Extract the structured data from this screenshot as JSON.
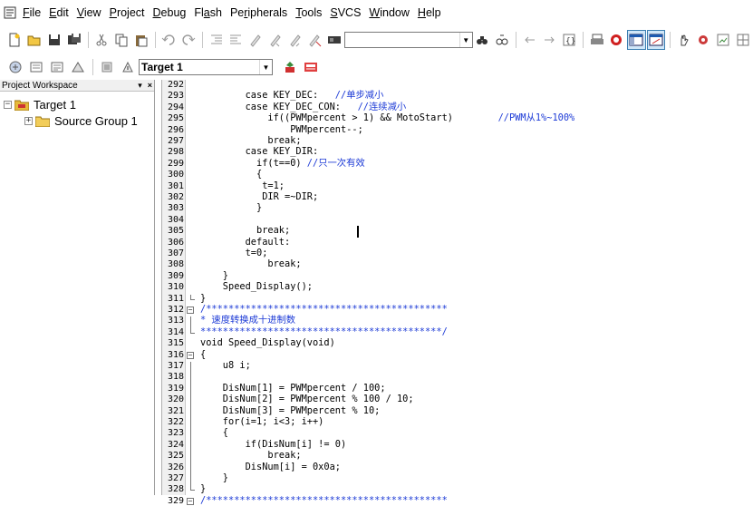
{
  "menu": {
    "items": [
      {
        "mnemonic": "F",
        "rest": "ile"
      },
      {
        "mnemonic": "E",
        "rest": "dit"
      },
      {
        "mnemonic": "V",
        "rest": "iew"
      },
      {
        "mnemonic": "P",
        "rest": "roject"
      },
      {
        "mnemonic": "D",
        "rest": "ebug"
      },
      {
        "pre": "Fl",
        "mnemonic": "a",
        "rest": "sh"
      },
      {
        "pre": "Pe",
        "mnemonic": "r",
        "rest": "ipherals"
      },
      {
        "mnemonic": "T",
        "rest": "ools"
      },
      {
        "mnemonic": "S",
        "rest": "VCS"
      },
      {
        "mnemonic": "W",
        "rest": "indow"
      },
      {
        "mnemonic": "H",
        "rest": "elp"
      }
    ]
  },
  "toolbar": {
    "find_combo_value": "",
    "target_combo_value": "Target 1"
  },
  "workspace": {
    "title": "Project Workspace",
    "pin_glyph": "▾",
    "close_glyph": "×",
    "tree": [
      {
        "label": "Target 1",
        "toggle": "−",
        "level": 0
      },
      {
        "label": "Source Group 1",
        "toggle": "+",
        "level": 1
      }
    ]
  },
  "editor": {
    "lines": [
      {
        "n": "292",
        "code": "",
        "comment": ""
      },
      {
        "n": "293",
        "code": "        case KEY_DEC:   ",
        "comment": "//单步减小"
      },
      {
        "n": "294",
        "code": "        case KEY_DEC_CON:   ",
        "comment": "//连续减小"
      },
      {
        "n": "295",
        "code": "            if((PWMpercent > 1) && MotoStart)        ",
        "comment": "//PWM从1%~100%"
      },
      {
        "n": "296",
        "code": "                PWMpercent--;",
        "comment": ""
      },
      {
        "n": "297",
        "code": "            break;",
        "comment": ""
      },
      {
        "n": "298",
        "code": "        case KEY_DIR:",
        "comment": ""
      },
      {
        "n": "299",
        "code": "          if(t==0) ",
        "comment": "//只一次有效"
      },
      {
        "n": "300",
        "code": "          {",
        "comment": ""
      },
      {
        "n": "301",
        "code": "           t=1;",
        "comment": ""
      },
      {
        "n": "302",
        "code": "           DIR =~DIR;",
        "comment": ""
      },
      {
        "n": "303",
        "code": "          }",
        "comment": ""
      },
      {
        "n": "304",
        "code": "",
        "comment": ""
      },
      {
        "n": "305",
        "code": "          break;",
        "comment": ""
      },
      {
        "n": "306",
        "code": "        default:",
        "comment": ""
      },
      {
        "n": "307",
        "code": "        t=0;",
        "comment": ""
      },
      {
        "n": "308",
        "code": "            break;",
        "comment": ""
      },
      {
        "n": "309",
        "code": "    }",
        "comment": ""
      },
      {
        "n": "310",
        "code": "    Speed_Display();",
        "comment": ""
      },
      {
        "n": "311",
        "code": "}",
        "comment": ""
      },
      {
        "n": "312",
        "code": "",
        "comment": "/*******************************************"
      },
      {
        "n": "313",
        "code": "",
        "comment": "* 速度转换成十进制数"
      },
      {
        "n": "314",
        "code": "",
        "comment": "*******************************************/"
      },
      {
        "n": "315",
        "code": "void Speed_Display(void)",
        "comment": ""
      },
      {
        "n": "316",
        "code": "{",
        "comment": ""
      },
      {
        "n": "317",
        "code": "    u8 i;",
        "comment": ""
      },
      {
        "n": "318",
        "code": "",
        "comment": ""
      },
      {
        "n": "319",
        "code": "    DisNum[1] = PWMpercent / 100;",
        "comment": ""
      },
      {
        "n": "320",
        "code": "    DisNum[2] = PWMpercent % 100 / 10;",
        "comment": ""
      },
      {
        "n": "321",
        "code": "    DisNum[3] = PWMpercent % 10;",
        "comment": ""
      },
      {
        "n": "322",
        "code": "    for(i=1; i<3; i++)",
        "comment": ""
      },
      {
        "n": "323",
        "code": "    {",
        "comment": ""
      },
      {
        "n": "324",
        "code": "        if(DisNum[i] != 0)",
        "comment": ""
      },
      {
        "n": "325",
        "code": "            break;",
        "comment": ""
      },
      {
        "n": "326",
        "code": "        DisNum[i] = 0x0a;",
        "comment": ""
      },
      {
        "n": "327",
        "code": "    }",
        "comment": ""
      },
      {
        "n": "328",
        "code": "}",
        "comment": ""
      },
      {
        "n": "329",
        "code": "",
        "comment": "/*******************************************"
      }
    ]
  },
  "colors": {
    "comment": "#1c3ad6",
    "gutter_bg": "#f0f0f0",
    "active_button_bg": "#cfe6f8"
  }
}
